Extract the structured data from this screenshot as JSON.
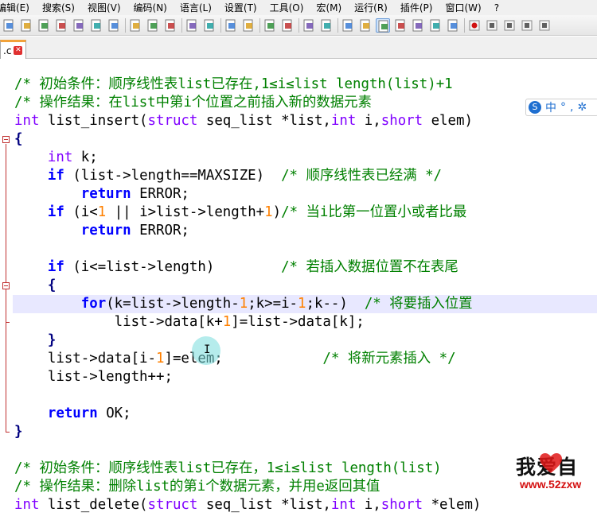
{
  "menu": [
    "编辑(E)",
    "搜索(S)",
    "视图(V)",
    "编码(N)",
    "语言(L)",
    "设置(T)",
    "工具(O)",
    "宏(M)",
    "运行(R)",
    "插件(P)",
    "窗口(W)",
    "?"
  ],
  "toolbar": {
    "buttons": [
      "new-file-icon",
      "open-file-icon",
      "save-icon",
      "save-all-icon",
      "close-icon",
      "close-all-icon",
      "print-icon",
      "cut-icon",
      "copy-icon",
      "paste-icon",
      "undo-icon",
      "redo-icon",
      "find-icon",
      "replace-icon",
      "zoom-in-icon",
      "zoom-out-icon",
      "sync-vertical-icon",
      "sync-horizontal-icon",
      "word-wrap-icon",
      "show-all-chars-icon",
      "indent-guide-icon",
      "doc-map-icon",
      "function-list-icon",
      "folder-workspace-icon",
      "monitor-icon",
      "record-macro-icon",
      "stop-macro-icon",
      "play-macro-icon",
      "run-macro-multiple-icon",
      "save-macro-icon"
    ]
  },
  "tab": {
    "label": ".c",
    "close": "✕"
  },
  "code_lines": [
    {
      "segs": [
        [
          "cm",
          "/* 初始条件：顺序线性表list已存在,1≤i≤list length(list)+1"
        ]
      ]
    },
    {
      "segs": [
        [
          "cm",
          "/* 操作结果：在list中第i个位置之前插入新的数据元素"
        ]
      ]
    },
    {
      "segs": [
        [
          "ty",
          "int"
        ],
        [
          "pl",
          " list_insert("
        ],
        [
          "ty",
          "struct"
        ],
        [
          "pl",
          " seq_list *list,"
        ],
        [
          "ty",
          "int"
        ],
        [
          "pl",
          " i,"
        ],
        [
          "ty",
          "short"
        ],
        [
          "pl",
          " elem)"
        ]
      ]
    },
    {
      "segs": [
        [
          "op",
          "{"
        ]
      ]
    },
    {
      "segs": [
        [
          "pl",
          "    "
        ],
        [
          "ty",
          "int"
        ],
        [
          "pl",
          " k;"
        ]
      ]
    },
    {
      "segs": [
        [
          "pl",
          "    "
        ],
        [
          "kw",
          "if"
        ],
        [
          "pl",
          " (list->length==MAXSIZE)  "
        ],
        [
          "cm",
          "/* 顺序线性表已经满 */"
        ]
      ]
    },
    {
      "segs": [
        [
          "pl",
          "        "
        ],
        [
          "kw",
          "return"
        ],
        [
          "pl",
          " ERROR;"
        ]
      ]
    },
    {
      "segs": [
        [
          "pl",
          "    "
        ],
        [
          "kw",
          "if"
        ],
        [
          "pl",
          " (i<"
        ],
        [
          "num",
          "1"
        ],
        [
          "pl",
          " || i>list->length+"
        ],
        [
          "num",
          "1"
        ],
        [
          "pl",
          ")"
        ],
        [
          "cm",
          "/* 当i比第一位置小或者比最"
        ]
      ]
    },
    {
      "segs": [
        [
          "pl",
          "        "
        ],
        [
          "kw",
          "return"
        ],
        [
          "pl",
          " ERROR;"
        ]
      ]
    },
    {
      "segs": []
    },
    {
      "segs": [
        [
          "pl",
          "    "
        ],
        [
          "kw",
          "if"
        ],
        [
          "pl",
          " (i<=list->length)        "
        ],
        [
          "cm",
          "/* 若插入数据位置不在表尾"
        ]
      ]
    },
    {
      "segs": [
        [
          "pl",
          "    "
        ],
        [
          "op",
          "{"
        ]
      ]
    },
    {
      "segs": [
        [
          "pl",
          "        "
        ],
        [
          "kw",
          "for"
        ],
        [
          "pl",
          "(k=list->length-"
        ],
        [
          "num",
          "1"
        ],
        [
          "pl",
          ";k>=i-"
        ],
        [
          "num",
          "1"
        ],
        [
          "pl",
          ";k--)  "
        ],
        [
          "cm",
          "/* 将要插入位置"
        ]
      ],
      "hl": true
    },
    {
      "segs": [
        [
          "pl",
          "            list->data[k+"
        ],
        [
          "num",
          "1"
        ],
        [
          "pl",
          "]=list->data[k];"
        ]
      ]
    },
    {
      "segs": [
        [
          "pl",
          "    "
        ],
        [
          "op",
          "}"
        ]
      ]
    },
    {
      "segs": [
        [
          "pl",
          "    list->data[i-"
        ],
        [
          "num",
          "1"
        ],
        [
          "pl",
          "]=elem;            "
        ],
        [
          "cm",
          "/* 将新元素插入 */"
        ]
      ]
    },
    {
      "segs": [
        [
          "pl",
          "    list->length++;"
        ]
      ]
    },
    {
      "segs": []
    },
    {
      "segs": [
        [
          "pl",
          "    "
        ],
        [
          "kw",
          "return"
        ],
        [
          "pl",
          " OK;"
        ]
      ]
    },
    {
      "segs": [
        [
          "op",
          "}"
        ]
      ]
    },
    {
      "segs": []
    },
    {
      "segs": [
        [
          "cm",
          "/* 初始条件：顺序线性表list已存在，1≤i≤list length(list)"
        ]
      ]
    },
    {
      "segs": [
        [
          "cm",
          "/* 操作结果：删除list的第i个数据元素，并用e返回其值"
        ]
      ]
    },
    {
      "segs": [
        [
          "ty",
          "int"
        ],
        [
          "pl",
          " list_delete("
        ],
        [
          "ty",
          "struct"
        ],
        [
          "pl",
          " seq_list *list,"
        ],
        [
          "ty",
          "int"
        ],
        [
          "pl",
          " i,"
        ],
        [
          "ty",
          "short"
        ],
        [
          "pl",
          " *elem)"
        ]
      ]
    }
  ],
  "ime": {
    "label1": "中",
    "label2": "°",
    "label3": ","
  },
  "watermark": {
    "title": "我爱自",
    "url": "www.52zxw"
  }
}
